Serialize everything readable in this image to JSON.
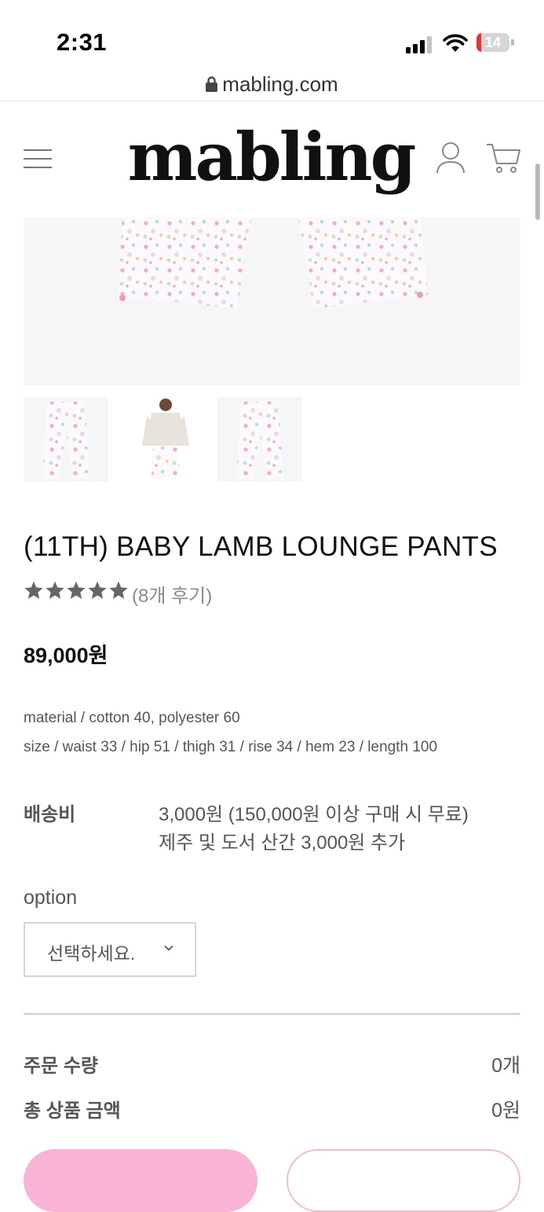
{
  "status_bar": {
    "time": "2:31",
    "battery": "14",
    "battery_level": 0.14
  },
  "browser": {
    "url": "mabling.com"
  },
  "header": {
    "logo": "mabling"
  },
  "product": {
    "title": "(11TH) BABY LAMB LOUNGE PANTS",
    "rating": 5,
    "review_count": "(8개 후기)",
    "price": "89,000원",
    "material": "material / cotton 40, polyester 60",
    "size": "size / waist 33 / hip 51 / thigh 31 / rise 34 / hem 23 / length 100"
  },
  "shipping": {
    "label": "배송비",
    "line1": "3,000원 (150,000원 이상 구매 시 무료)",
    "line2": "제주 및 도서 산간 3,000원 추가"
  },
  "option": {
    "label": "option",
    "placeholder": "선택하세요."
  },
  "summary": {
    "quantity_label": "주문 수량",
    "quantity_value": "0개",
    "total_label": "총 상품 금액",
    "total_value": "0원"
  },
  "colors": {
    "accent_pink": "#f9b3d6",
    "battery_red": "#e5342d"
  }
}
